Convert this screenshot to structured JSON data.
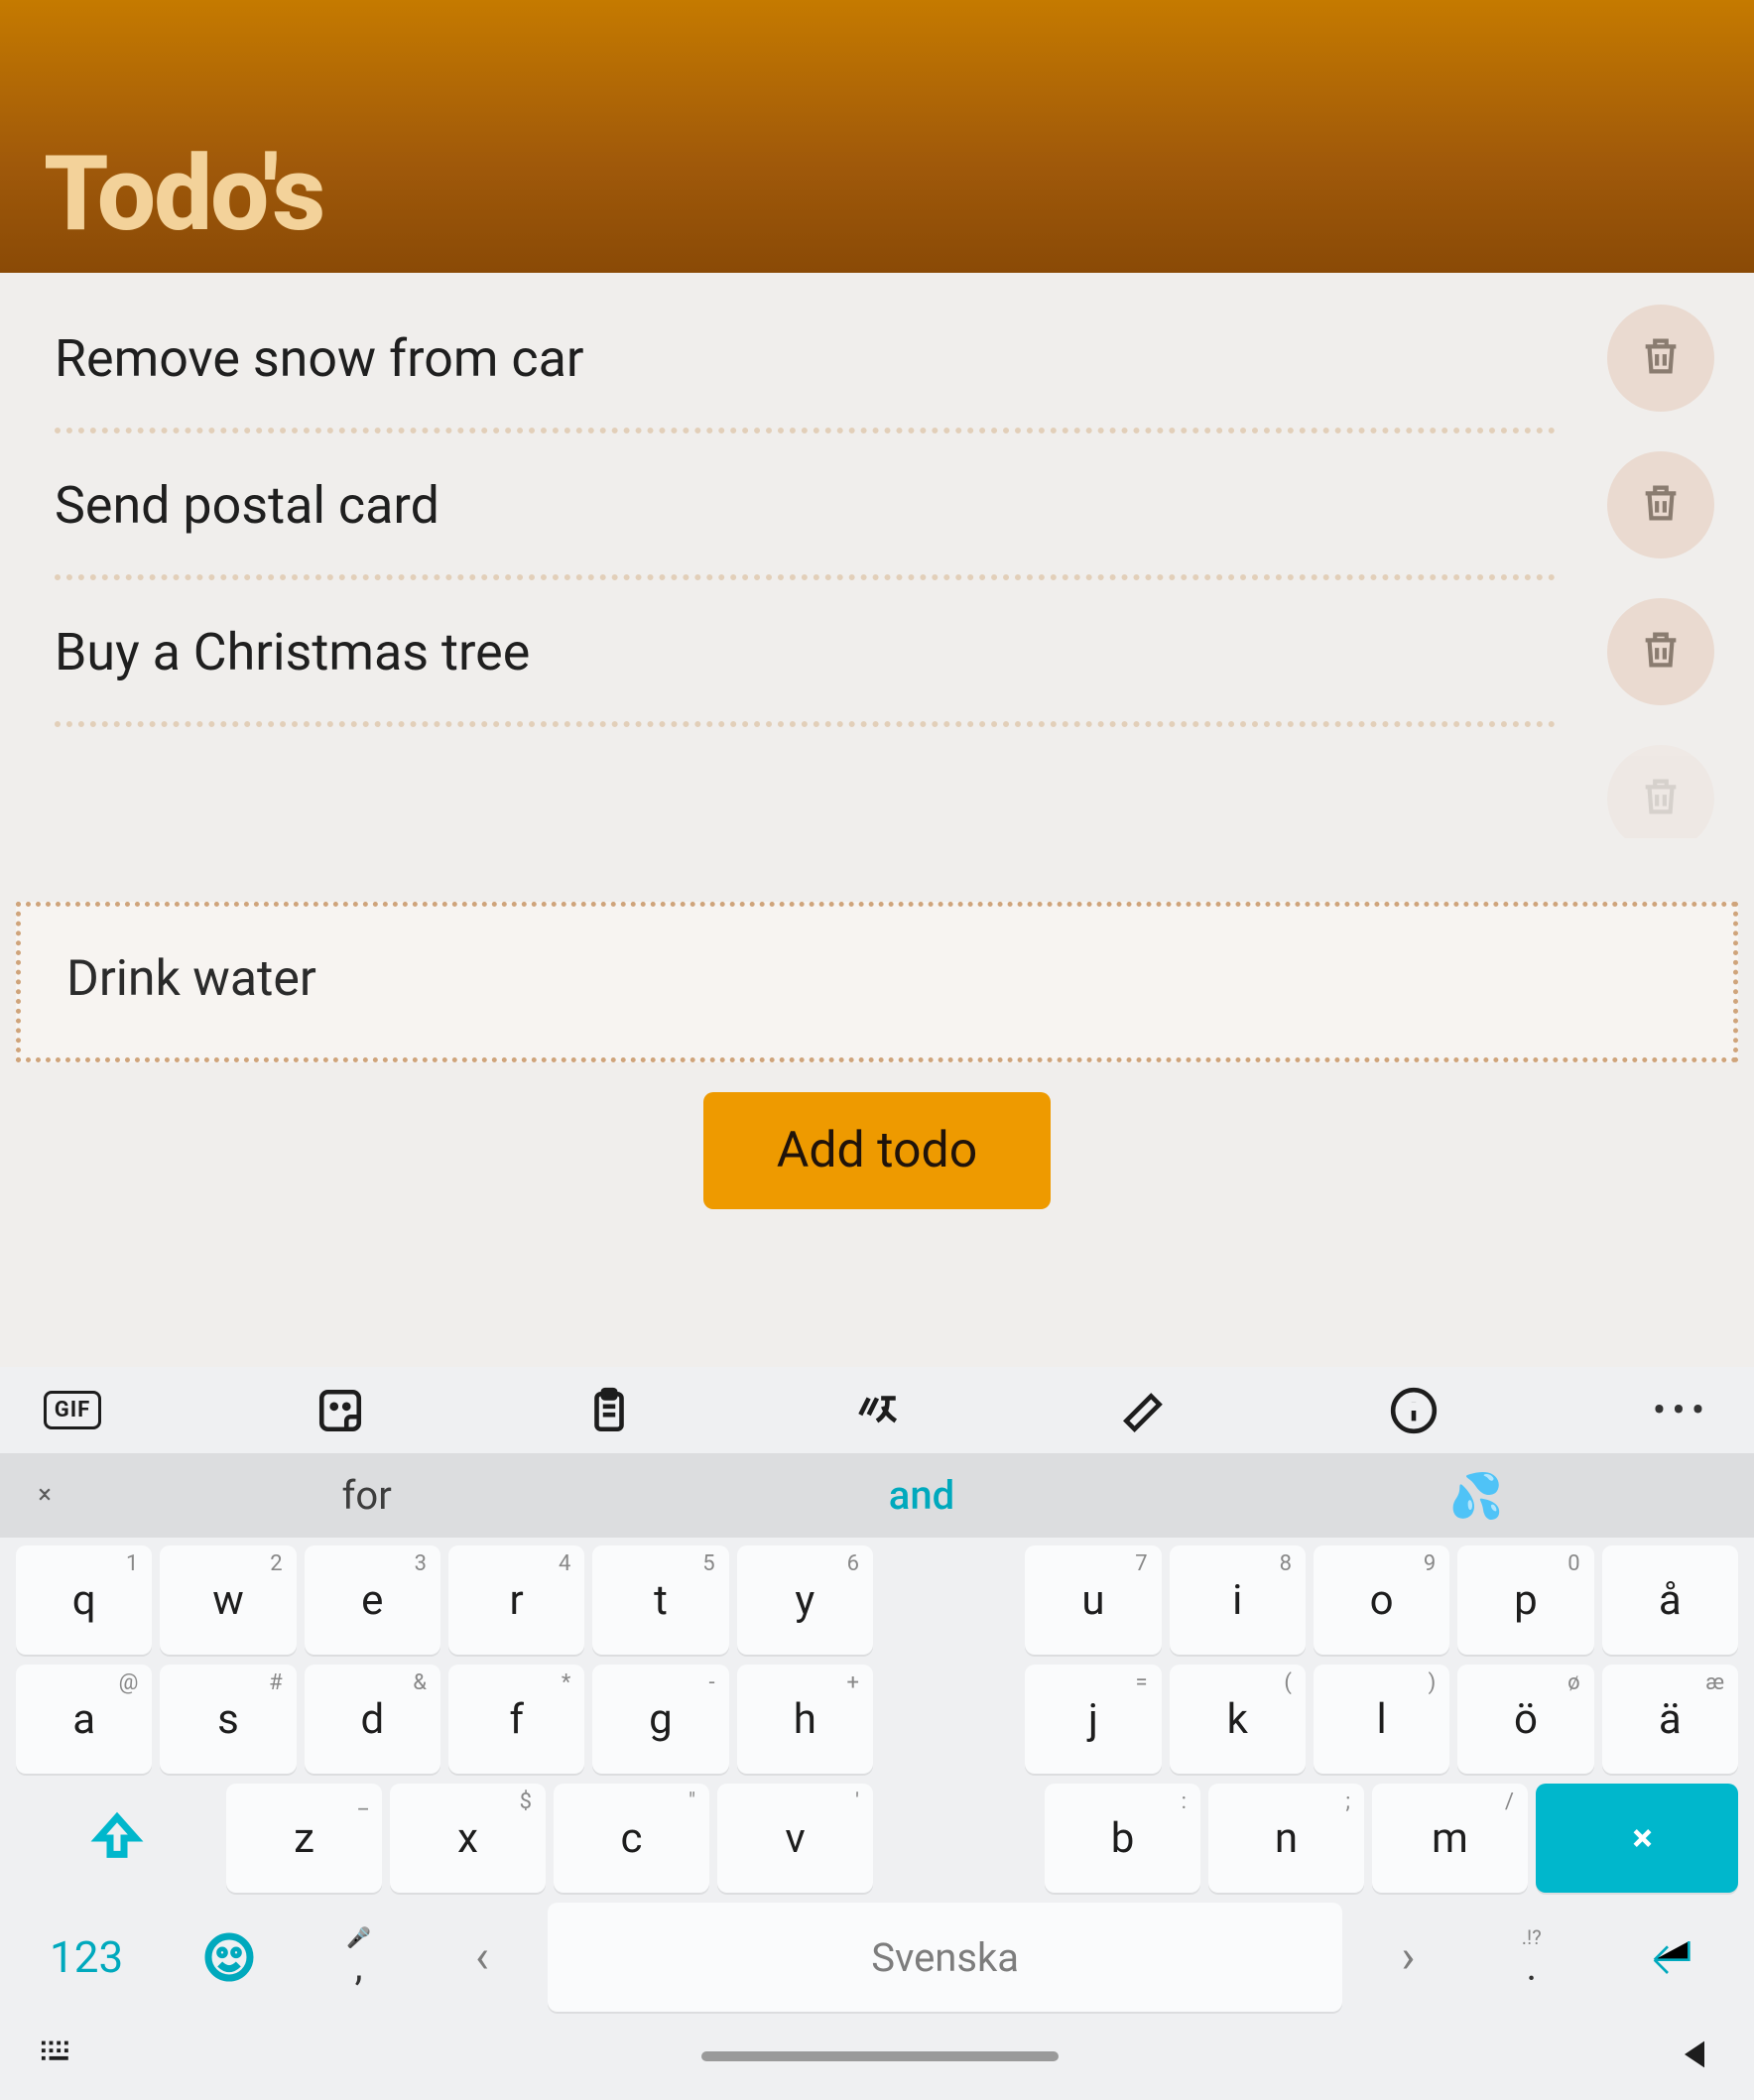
{
  "header": {
    "title": "Todo's"
  },
  "todos": [
    {
      "text": "Remove snow from car"
    },
    {
      "text": "Send postal card"
    },
    {
      "text": "Buy a Christmas tree"
    }
  ],
  "input": {
    "value": "Drink water"
  },
  "add_button": {
    "label": "Add todo"
  },
  "keyboard": {
    "suggestions": {
      "left": "for",
      "center": "and",
      "right_emoji": "💦"
    },
    "row1": [
      {
        "hint": "1",
        "main": "q"
      },
      {
        "hint": "2",
        "main": "w"
      },
      {
        "hint": "3",
        "main": "e"
      },
      {
        "hint": "4",
        "main": "r"
      },
      {
        "hint": "5",
        "main": "t"
      },
      {
        "hint": "6",
        "main": "y"
      },
      {
        "blank": true
      },
      {
        "hint": "7",
        "main": "u"
      },
      {
        "hint": "8",
        "main": "i"
      },
      {
        "hint": "9",
        "main": "o"
      },
      {
        "hint": "0",
        "main": "p"
      },
      {
        "hint": "",
        "main": "å"
      }
    ],
    "row2": [
      {
        "hint": "@",
        "main": "a"
      },
      {
        "hint": "#",
        "main": "s"
      },
      {
        "hint": "&",
        "main": "d"
      },
      {
        "hint": "*",
        "main": "f"
      },
      {
        "hint": "-",
        "main": "g"
      },
      {
        "hint": "+",
        "main": "h"
      },
      {
        "blank": true
      },
      {
        "hint": "=",
        "main": "j"
      },
      {
        "hint": "(",
        "main": "k"
      },
      {
        "hint": ")",
        "main": "l"
      },
      {
        "hint": "ø",
        "main": "ö"
      },
      {
        "hint": "æ",
        "main": "ä"
      }
    ],
    "row3": [
      {
        "hint": "_",
        "main": "z"
      },
      {
        "hint": "$",
        "main": "x"
      },
      {
        "hint": "\"",
        "main": "c"
      },
      {
        "hint": "'",
        "main": "v"
      },
      {
        "blank": true
      },
      {
        "hint": ":",
        "main": "b"
      },
      {
        "hint": ";",
        "main": "n"
      },
      {
        "hint": "/",
        "main": "m"
      }
    ],
    "row4": {
      "numkey": "123",
      "comma_hint": "🎤",
      "comma": ",",
      "space": "Svenska",
      "period_hint": ".!?",
      "period": ".",
      "left_arrow": "‹",
      "right_arrow": "›"
    }
  }
}
